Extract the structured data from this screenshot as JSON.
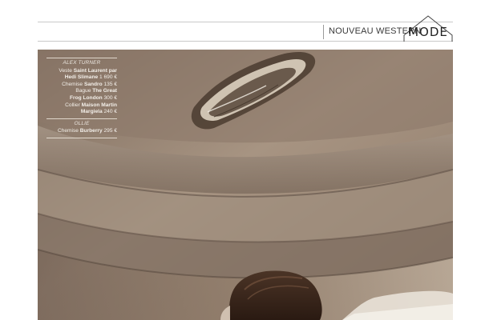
{
  "header": {
    "section_title": "NOUVEAU WESTERN",
    "logo_text": "MODE"
  },
  "credits": [
    {
      "name": "ALEX TURNER",
      "lines": [
        {
          "parts": [
            {
              "t": "Veste ",
              "b": false
            },
            {
              "t": "Saint Laurent par",
              "b": true
            }
          ]
        },
        {
          "parts": [
            {
              "t": "Hedi Slimane",
              "b": true
            },
            {
              "t": " 1 690 €",
              "b": false
            }
          ]
        },
        {
          "parts": [
            {
              "t": "Chemise ",
              "b": false
            },
            {
              "t": "Sandro",
              "b": true
            },
            {
              "t": " 135 €",
              "b": false
            }
          ]
        },
        {
          "parts": [
            {
              "t": "Bague ",
              "b": false
            },
            {
              "t": "The Great",
              "b": true
            }
          ]
        },
        {
          "parts": [
            {
              "t": "Frog London",
              "b": true
            },
            {
              "t": " 300 €",
              "b": false
            }
          ]
        },
        {
          "parts": [
            {
              "t": "Collier ",
              "b": false
            },
            {
              "t": "Maison Martin",
              "b": true
            }
          ]
        },
        {
          "parts": [
            {
              "t": "Margiela",
              "b": true
            },
            {
              "t": " 240 €",
              "b": false
            }
          ]
        }
      ]
    },
    {
      "name": "OLLIE",
      "lines": [
        {
          "parts": [
            {
              "t": "Chemise ",
              "b": false
            },
            {
              "t": "Burberry",
              "b": true
            },
            {
              "t": " 295 €",
              "b": false
            }
          ]
        }
      ]
    }
  ],
  "colors": {
    "ceiling": "#8b7868",
    "rule": "#c9c9c9",
    "text": "#3a3a3a"
  }
}
